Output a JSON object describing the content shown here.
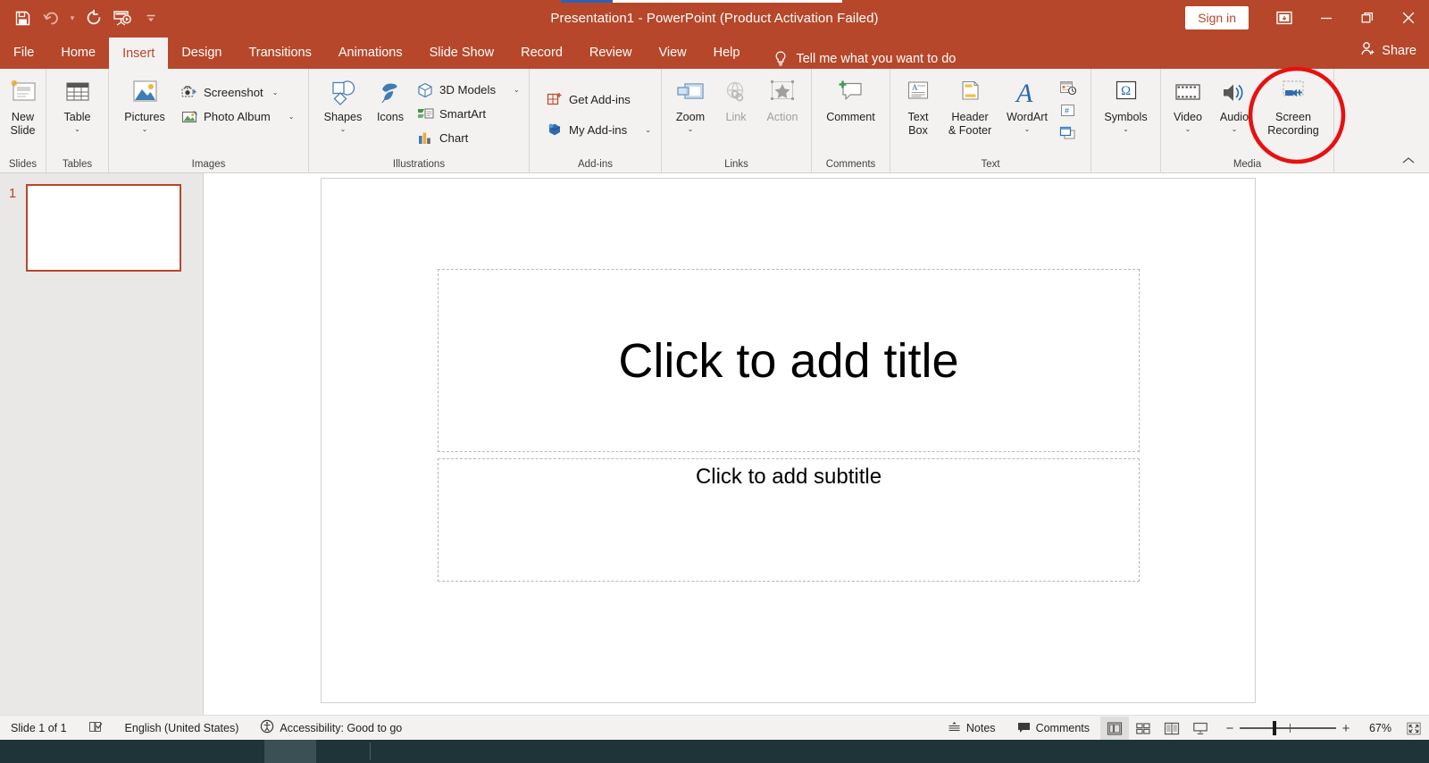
{
  "app": {
    "title": "Presentation1  -  PowerPoint (Product Activation Failed)",
    "accent_color": "#b7472a",
    "annotation_color": "#e8100f"
  },
  "quick_access": {
    "items": [
      {
        "name": "save-icon",
        "label": "Save"
      },
      {
        "name": "undo-icon",
        "label": "Undo"
      },
      {
        "name": "redo-icon",
        "label": "Redo"
      },
      {
        "name": "start-from-beginning-icon",
        "label": "Start From Beginning"
      },
      {
        "name": "customize-quick-access-toolbar-icon",
        "label": "Customize Quick Access Toolbar"
      }
    ]
  },
  "titlebar": {
    "sign_in": "Sign in",
    "ribbon_display_options": "Ribbon Display Options",
    "minimize": "Minimize",
    "restore": "Restore Down",
    "close": "Close"
  },
  "tabs": [
    {
      "label": "File",
      "active": false
    },
    {
      "label": "Home",
      "active": false
    },
    {
      "label": "Insert",
      "active": true
    },
    {
      "label": "Design",
      "active": false
    },
    {
      "label": "Transitions",
      "active": false
    },
    {
      "label": "Animations",
      "active": false
    },
    {
      "label": "Slide Show",
      "active": false
    },
    {
      "label": "Record",
      "active": false
    },
    {
      "label": "Review",
      "active": false
    },
    {
      "label": "View",
      "active": false
    },
    {
      "label": "Help",
      "active": false
    }
  ],
  "tell_me": {
    "placeholder": "Tell me what you want to do",
    "icon": "lightbulb-icon"
  },
  "share": {
    "label": "Share",
    "icon": "share-person-icon"
  },
  "ribbon": {
    "collapse_label": "Collapse the Ribbon",
    "groups": [
      {
        "name": "slides",
        "label": "Slides",
        "big_buttons": [
          {
            "name": "new-slide",
            "line1": "New",
            "line2": "Slide",
            "dropdown": true,
            "icon": "new-slide-icon",
            "disabled": false
          }
        ],
        "small_buttons": []
      },
      {
        "name": "tables",
        "label": "Tables",
        "big_buttons": [
          {
            "name": "table",
            "line1": "Table",
            "line2": "",
            "dropdown": true,
            "icon": "table-icon",
            "disabled": false
          }
        ],
        "small_buttons": []
      },
      {
        "name": "images",
        "label": "Images",
        "big_buttons": [
          {
            "name": "pictures",
            "line1": "Pictures",
            "line2": "",
            "dropdown": true,
            "icon": "pictures-icon",
            "disabled": false
          }
        ],
        "small_buttons": [
          {
            "name": "screenshot",
            "label": "Screenshot",
            "icon": "screenshot-icon",
            "dropdown": true
          },
          {
            "name": "photo-album",
            "label": "Photo Album",
            "icon": "photo-album-icon",
            "dropdown": true
          }
        ]
      },
      {
        "name": "illustrations",
        "label": "Illustrations",
        "big_buttons": [
          {
            "name": "shapes",
            "line1": "Shapes",
            "line2": "",
            "dropdown": true,
            "icon": "shapes-icon",
            "disabled": false
          },
          {
            "name": "icons",
            "line1": "Icons",
            "line2": "",
            "dropdown": false,
            "icon": "icons-icon",
            "disabled": false
          }
        ],
        "small_buttons": [
          {
            "name": "3d-models",
            "label": "3D Models",
            "icon": "3d-model-icon",
            "dropdown": true
          },
          {
            "name": "smartart",
            "label": "SmartArt",
            "icon": "smartart-icon",
            "dropdown": false
          },
          {
            "name": "chart",
            "label": "Chart",
            "icon": "chart-icon",
            "dropdown": false
          }
        ]
      },
      {
        "name": "add-ins",
        "label": "Add-ins",
        "big_buttons": [],
        "small_buttons": [
          {
            "name": "get-add-ins",
            "label": "Get Add-ins",
            "icon": "get-add-ins-icon",
            "dropdown": false
          },
          {
            "name": "my-add-ins",
            "label": "My Add-ins",
            "icon": "my-add-ins-icon",
            "dropdown": true
          }
        ]
      },
      {
        "name": "links",
        "label": "Links",
        "big_buttons": [
          {
            "name": "zoom",
            "line1": "Zoom",
            "line2": "",
            "dropdown": true,
            "icon": "zoom-icon",
            "disabled": false
          },
          {
            "name": "link",
            "line1": "Link",
            "line2": "",
            "dropdown": false,
            "icon": "link-icon",
            "disabled": true
          },
          {
            "name": "action",
            "line1": "Action",
            "line2": "",
            "dropdown": false,
            "icon": "action-icon",
            "disabled": true
          }
        ],
        "small_buttons": []
      },
      {
        "name": "comments",
        "label": "Comments",
        "big_buttons": [
          {
            "name": "comment",
            "line1": "Comment",
            "line2": "",
            "dropdown": false,
            "icon": "comment-icon",
            "disabled": false
          }
        ],
        "small_buttons": []
      },
      {
        "name": "text",
        "label": "Text",
        "big_buttons": [
          {
            "name": "text-box",
            "line1": "Text",
            "line2": "Box",
            "dropdown": false,
            "icon": "text-box-icon",
            "disabled": false
          },
          {
            "name": "header-and-footer",
            "line1": "Header",
            "line2": "& Footer",
            "dropdown": false,
            "icon": "header-footer-icon",
            "disabled": false
          },
          {
            "name": "wordart",
            "line1": "WordArt",
            "line2": "",
            "dropdown": true,
            "icon": "wordart-icon",
            "disabled": false
          }
        ],
        "mini_buttons": [
          {
            "name": "date-and-time",
            "icon": "date-time-icon"
          },
          {
            "name": "slide-number",
            "icon": "slide-number-icon"
          },
          {
            "name": "object",
            "icon": "object-icon"
          }
        ],
        "small_buttons": []
      },
      {
        "name": "symbols",
        "label": "",
        "big_buttons": [
          {
            "name": "symbols",
            "line1": "Symbols",
            "line2": "",
            "dropdown": true,
            "icon": "omega-icon",
            "disabled": false
          }
        ],
        "small_buttons": []
      },
      {
        "name": "media",
        "label": "Media",
        "big_buttons": [
          {
            "name": "video",
            "line1": "Video",
            "line2": "",
            "dropdown": true,
            "icon": "video-icon",
            "disabled": false
          },
          {
            "name": "audio",
            "line1": "Audio",
            "line2": "",
            "dropdown": true,
            "icon": "audio-icon",
            "disabled": false
          },
          {
            "name": "screen-recording",
            "line1": "Screen",
            "line2": "Recording",
            "dropdown": false,
            "icon": "screen-recording-icon",
            "disabled": false
          }
        ],
        "small_buttons": []
      }
    ]
  },
  "thumbnails": {
    "slides": [
      {
        "number": "1",
        "selected": true
      }
    ]
  },
  "slide": {
    "title_placeholder": "Click to add title",
    "subtitle_placeholder": "Click to add subtitle"
  },
  "status_bar": {
    "slide_count": "Slide 1 of 1",
    "language": "English (United States)",
    "accessibility": "Accessibility: Good to go",
    "notes": "Notes",
    "comments": "Comments",
    "zoom_percent": "67%",
    "views": [
      {
        "name": "normal-view",
        "label": "Normal",
        "active": true
      },
      {
        "name": "slide-sorter-view",
        "label": "Slide Sorter",
        "active": false
      },
      {
        "name": "reading-view",
        "label": "Reading View",
        "active": false
      },
      {
        "name": "slide-show-view",
        "label": "Slide Show",
        "active": false
      }
    ],
    "zoom_out": "−",
    "zoom_in": "+",
    "fit_to_window": "Fit slide to current window"
  },
  "annotation": {
    "name": "screen-recording-highlight-circle",
    "target": "Screen Recording"
  }
}
